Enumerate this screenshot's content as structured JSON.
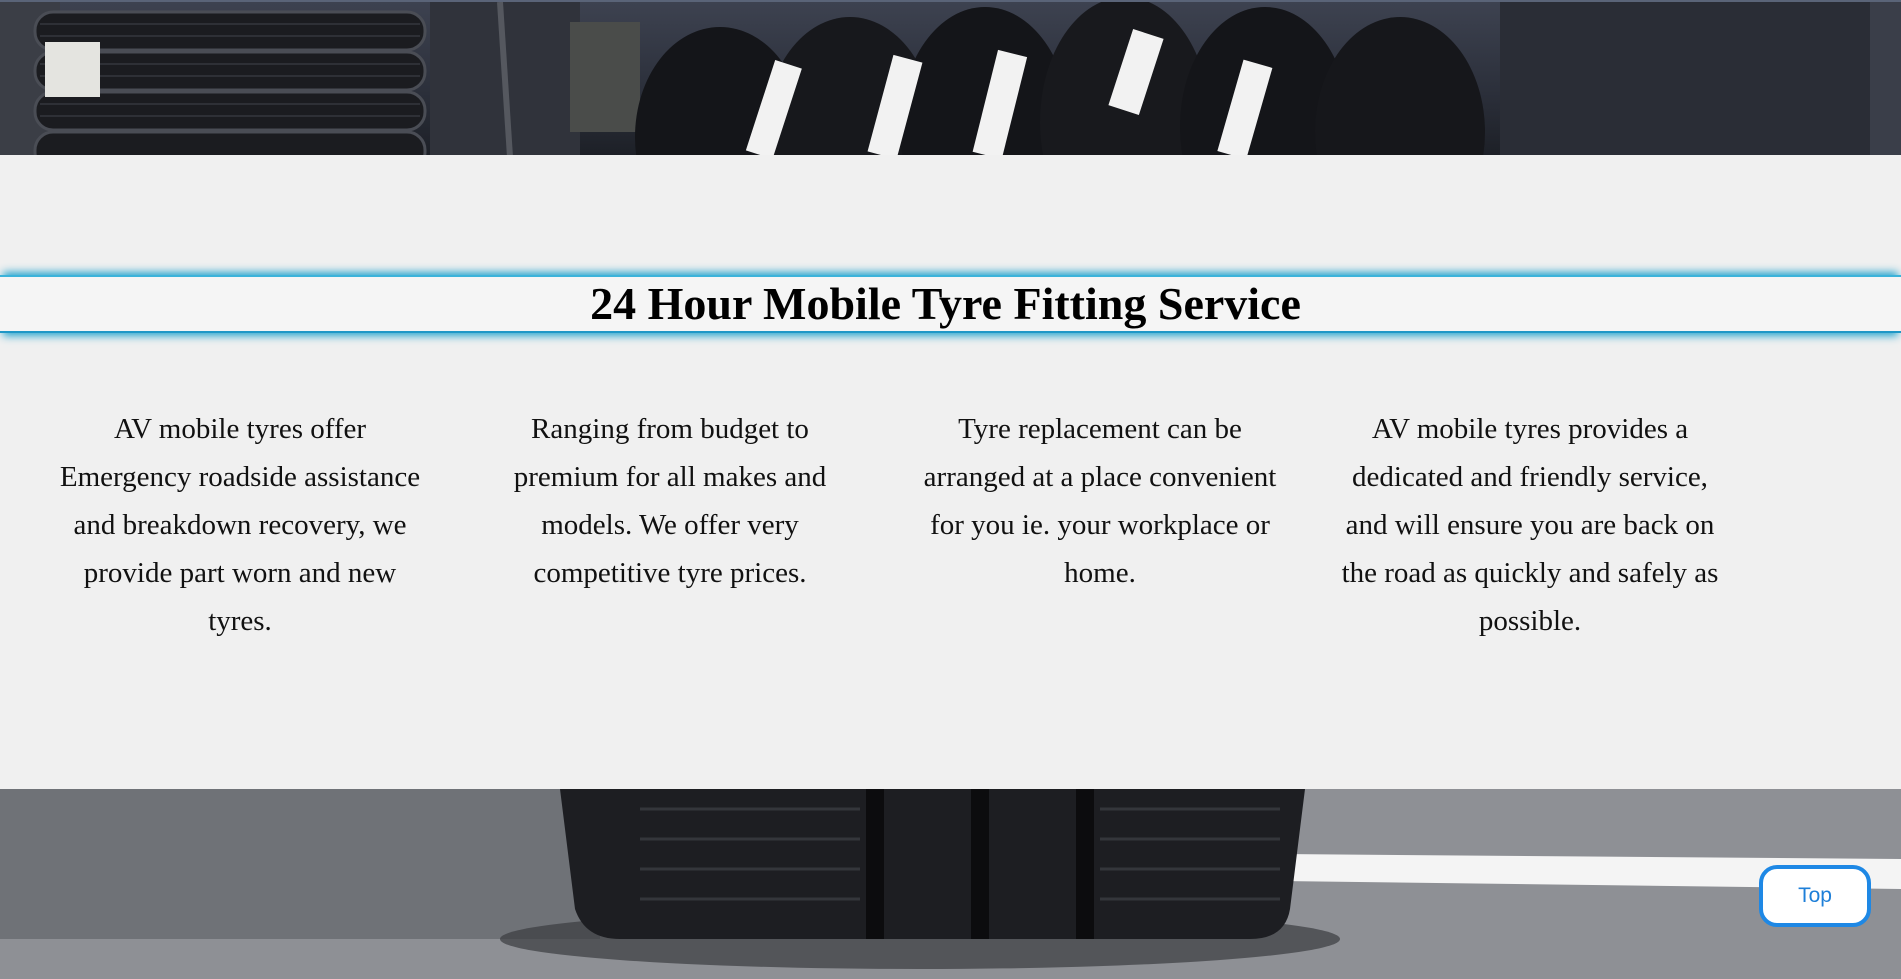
{
  "hero_top": {
    "image": "tyre-rack-photo"
  },
  "banner": {
    "title": "24 Hour Mobile Tyre Fitting Service"
  },
  "features": [
    {
      "text": "AV mobile tyres offer Emergency roadside assistance and breakdown recovery, we provide part worn and new tyres."
    },
    {
      "text": "Ranging from budget to premium for all makes and models. We offer very competitive tyre prices."
    },
    {
      "text": "Tyre replacement can be arranged at a place convenient for you ie. your workplace or home."
    },
    {
      "text": "AV mobile tyres provides a dedicated and friendly service, and will ensure you are back on the road as quickly and safely as possible."
    }
  ],
  "hero_bottom": {
    "image": "tyre-on-road-photo"
  },
  "top_button": {
    "label": "Top"
  },
  "colors": {
    "accent_blue": "#1e88e5",
    "banner_glow": "#2aa6cf",
    "panel_bg": "#f0f0f0"
  }
}
